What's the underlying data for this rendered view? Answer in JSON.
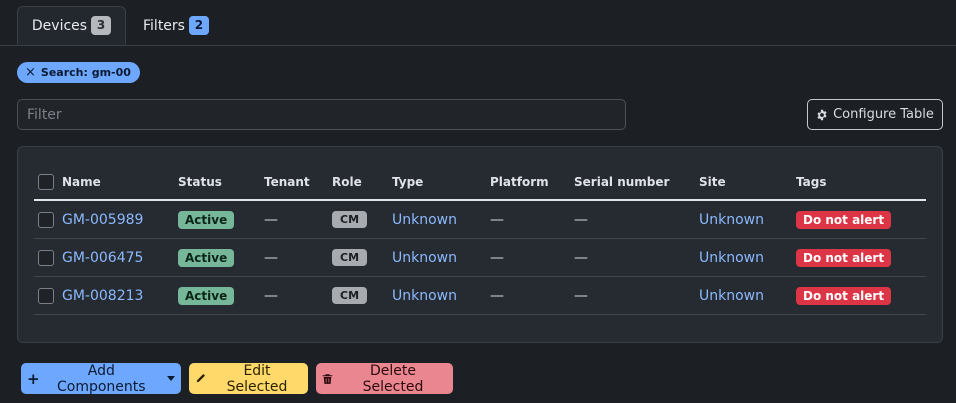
{
  "tabs": [
    {
      "label": "Devices",
      "count": "3"
    },
    {
      "label": "Filters",
      "count": "2"
    }
  ],
  "search_chip": {
    "close_glyph": "×",
    "label": "Search: gm-00"
  },
  "filter": {
    "placeholder": "Filter",
    "value": ""
  },
  "configure_button": {
    "label": "Configure Table",
    "icon": "gear-icon"
  },
  "table": {
    "columns": [
      "Name",
      "Status",
      "Tenant",
      "Role",
      "Type",
      "Platform",
      "Serial number",
      "Site",
      "Tags"
    ],
    "rows": [
      {
        "name": "GM-005989",
        "status": "Active",
        "tenant": "—",
        "role": "CM",
        "type": "Unknown",
        "platform": "—",
        "serial": "—",
        "site": "Unknown",
        "tag": "Do not alert"
      },
      {
        "name": "GM-006475",
        "status": "Active",
        "tenant": "—",
        "role": "CM",
        "type": "Unknown",
        "platform": "—",
        "serial": "—",
        "site": "Unknown",
        "tag": "Do not alert"
      },
      {
        "name": "GM-008213",
        "status": "Active",
        "tenant": "—",
        "role": "CM",
        "type": "Unknown",
        "platform": "—",
        "serial": "—",
        "site": "Unknown",
        "tag": "Do not alert"
      }
    ]
  },
  "actions": {
    "add_label": "Add Components",
    "edit_label": "Edit Selected",
    "delete_label": "Delete Selected"
  },
  "colors": {
    "primary": "#6ea8fe",
    "success": "#75b798",
    "danger": "#dc3545",
    "warning": "#ffda6a",
    "secondary": "#a7abb0"
  }
}
